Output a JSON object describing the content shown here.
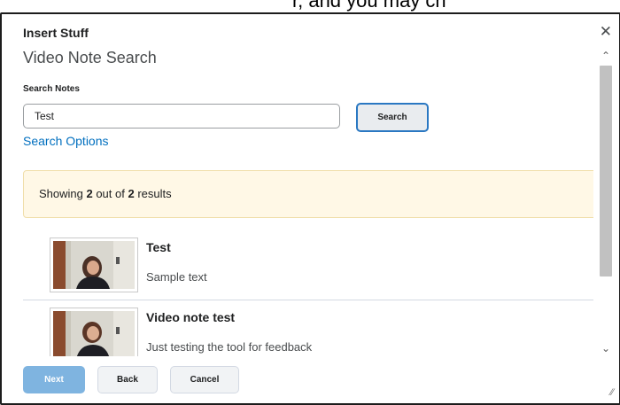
{
  "top_partial_text": "r, and you may ch",
  "dialog": {
    "title": "Insert Stuff",
    "close_icon": "close-icon"
  },
  "page": {
    "title": "Video Note Search",
    "search_label": "Search Notes",
    "search_value": "Test",
    "search_button": "Search",
    "search_options": "Search Options"
  },
  "results_banner": {
    "prefix": "Showing ",
    "shown": "2",
    "middle": " out of ",
    "total": "2",
    "suffix": " results"
  },
  "results": [
    {
      "title": "Test",
      "description": "Sample text"
    },
    {
      "title": "Video note test",
      "description": "Just testing the tool for feedback"
    }
  ],
  "scrollbar": {
    "up_icon": "chevron-up-icon",
    "down_icon": "chevron-down-icon"
  },
  "footer": {
    "next": "Next",
    "back": "Back",
    "cancel": "Cancel"
  },
  "colors": {
    "accent": "#006fbf",
    "next_button": "#7fb4e0",
    "banner_bg": "#fff8e6"
  }
}
